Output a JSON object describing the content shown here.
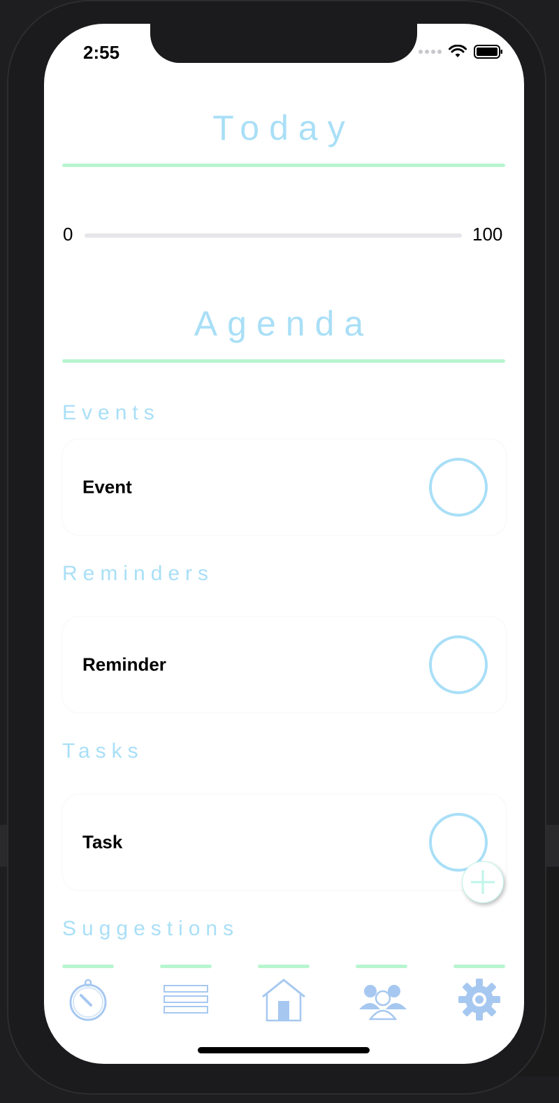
{
  "status_bar": {
    "time": "2:55"
  },
  "today": {
    "title": "Today"
  },
  "slider": {
    "min_label": "0",
    "max_label": "100",
    "value": 0
  },
  "agenda": {
    "title": "Agenda"
  },
  "sections": {
    "events": {
      "title": "Events",
      "item": "Event"
    },
    "reminders": {
      "title": "Reminders",
      "item": "Reminder"
    },
    "tasks": {
      "title": "Tasks",
      "item": "Task"
    },
    "suggestions": {
      "title": "Suggestions"
    }
  },
  "tabs": [
    {
      "name": "timer",
      "icon": "stopwatch-icon"
    },
    {
      "name": "list",
      "icon": "list-icon"
    },
    {
      "name": "home",
      "icon": "house-icon"
    },
    {
      "name": "people",
      "icon": "group-icon"
    },
    {
      "name": "settings",
      "icon": "gear-icon"
    }
  ],
  "colors": {
    "title_blue": "#a9dff7",
    "rule_green": "#b7f5cf",
    "icon_blue": "#a6c8f0"
  }
}
